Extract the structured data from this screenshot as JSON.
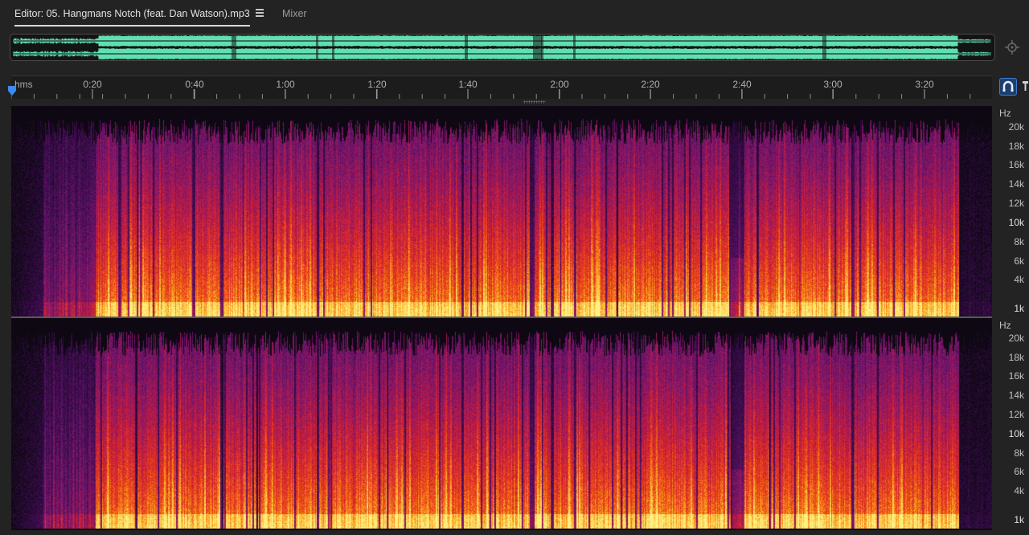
{
  "tabs": {
    "editor_label": "Editor: 05. Hangmans Notch (feat. Dan Watson).mp3",
    "mixer_label": "Mixer"
  },
  "colors": {
    "waveform": "#5ee0b0",
    "background": "#232323",
    "accent": "#3f7ad0"
  },
  "ruler": {
    "unit": "hms",
    "labels": [
      "0:20",
      "0:40",
      "1:00",
      "1:20",
      "1:40",
      "2:00",
      "2:20",
      "2:40",
      "3:00",
      "3:20"
    ]
  },
  "frequency_axis": {
    "unit": "Hz",
    "labels": [
      "20k",
      "18k",
      "16k",
      "14k",
      "12k",
      "10k",
      "8k",
      "6k",
      "4k",
      "1k"
    ]
  },
  "icons": {
    "tab_menu": "hamburger-menu-icon",
    "zoom": "zoom-target-icon",
    "snap": "snap-magnet-icon",
    "pin": "pin-icon",
    "playhead": "playhead-marker-icon"
  }
}
